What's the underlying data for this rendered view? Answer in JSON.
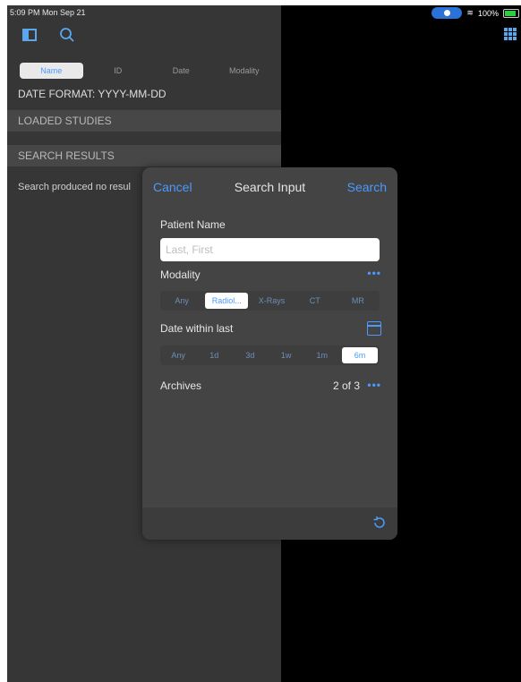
{
  "status": {
    "time": "5:09 PM  Mon Sep 21",
    "battery": "100%"
  },
  "left_pane": {
    "tabs": [
      "Name",
      "ID",
      "Date",
      "Modality"
    ],
    "date_format": "DATE FORMAT: YYYY-MM-DD",
    "loaded_studies": "LOADED STUDIES",
    "search_results": "SEARCH RESULTS",
    "no_results": "Search produced no resul"
  },
  "modal": {
    "cancel": "Cancel",
    "title": "Search Input",
    "search": "Search",
    "patient_name_label": "Patient Name",
    "patient_name_placeholder": "Last, First",
    "modality_label": "Modality",
    "modality_options": [
      "Any",
      "Radiol...",
      "X-Rays",
      "CT",
      "MR"
    ],
    "modality_selected": "Radiol...",
    "date_label": "Date within last",
    "date_options": [
      "Any",
      "1d",
      "3d",
      "1w",
      "1m",
      "6m"
    ],
    "date_selected": "6m",
    "archives_label": "Archives",
    "archives_count": "2 of 3",
    "more_glyph": "•••"
  },
  "colors": {
    "accent": "#4a9aff",
    "pane": "#363636",
    "modal": "#444444"
  }
}
